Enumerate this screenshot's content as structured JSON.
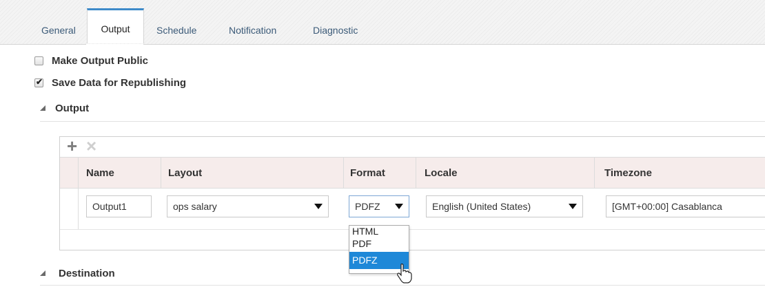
{
  "tabs": [
    {
      "label": "General",
      "active": false
    },
    {
      "label": "Output",
      "active": true
    },
    {
      "label": "Schedule",
      "active": false
    },
    {
      "label": "Notification",
      "active": false
    },
    {
      "label": "Diagnostic",
      "active": false
    }
  ],
  "options": {
    "make_public": {
      "label": "Make Output Public",
      "checked": false
    },
    "save_data": {
      "label": "Save Data for Republishing",
      "checked": true
    }
  },
  "sections": {
    "output": "Output",
    "destination": "Destination"
  },
  "toolbar": {
    "add_icon": "plus-icon",
    "delete_icon": "x-icon"
  },
  "table": {
    "headers": [
      "Name",
      "Layout",
      "Format",
      "Locale",
      "Timezone"
    ],
    "row": {
      "name": "Output1",
      "layout": "ops salary",
      "format": "PDFZ",
      "locale": "English (United States)",
      "timezone": "[GMT+00:00] Casablanca"
    }
  },
  "format_dropdown": {
    "options": [
      "HTML",
      "PDF",
      "PDFZ"
    ],
    "selected": "PDFZ"
  },
  "colors": {
    "accent": "#3d8ac9",
    "selection": "#1e88d8",
    "header_bg": "#f6eceb"
  }
}
